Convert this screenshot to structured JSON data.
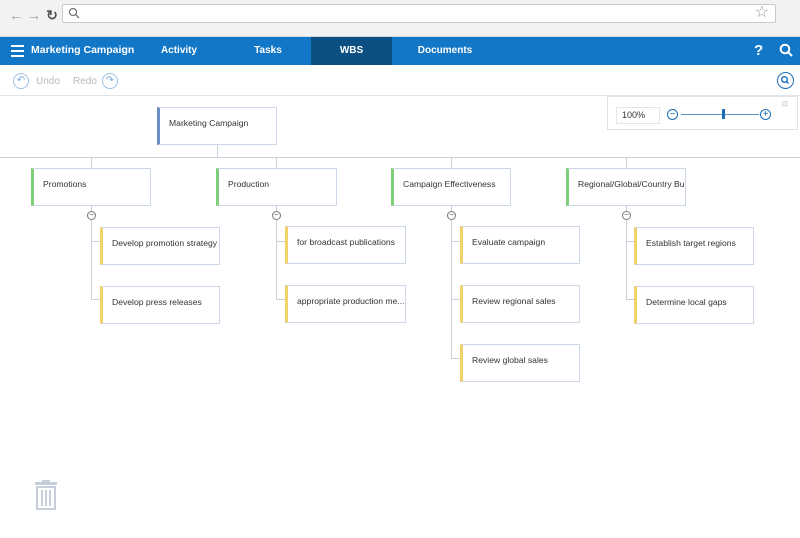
{
  "browser": {
    "back_icon": "arrow-left-icon",
    "forward_icon": "arrow-right-icon",
    "reload_icon": "reload-icon",
    "url": "",
    "bookmark_icon": "star-icon"
  },
  "appbar": {
    "title": "Marketing Campaign",
    "tabs": [
      {
        "label": "Activity"
      },
      {
        "label": "Tasks"
      },
      {
        "label": "WBS"
      },
      {
        "label": "Documents"
      }
    ],
    "help": "?",
    "colors": {
      "bar": "#1277c6",
      "active_tab": "#0b4f83"
    }
  },
  "toolbar": {
    "undo": "Undo",
    "redo": "Redo"
  },
  "zoom": {
    "value": "100%",
    "minus": "−",
    "plus": "+"
  },
  "wbs": {
    "root": "Marketing Campaign",
    "groups": [
      {
        "label": "Promotions",
        "children": [
          "Develop promotion strategy",
          "Develop press releases"
        ]
      },
      {
        "label": "Production",
        "children": [
          "for broadcast publications",
          "appropriate production me..."
        ]
      },
      {
        "label": "Campaign Effectiveness",
        "children": [
          "Evaluate campaign",
          "Review regional sales",
          "Review global sales"
        ]
      },
      {
        "label": "Regional/Global/Country Bu...",
        "children": [
          "Establish target regions",
          "Determine local gaps"
        ]
      }
    ],
    "collapse_symbol": "−",
    "colors": {
      "root": "#6b8fc4",
      "group": "#7fcf7a",
      "task": "#f1d26a"
    }
  },
  "trash": {
    "icon": "trash-icon"
  }
}
